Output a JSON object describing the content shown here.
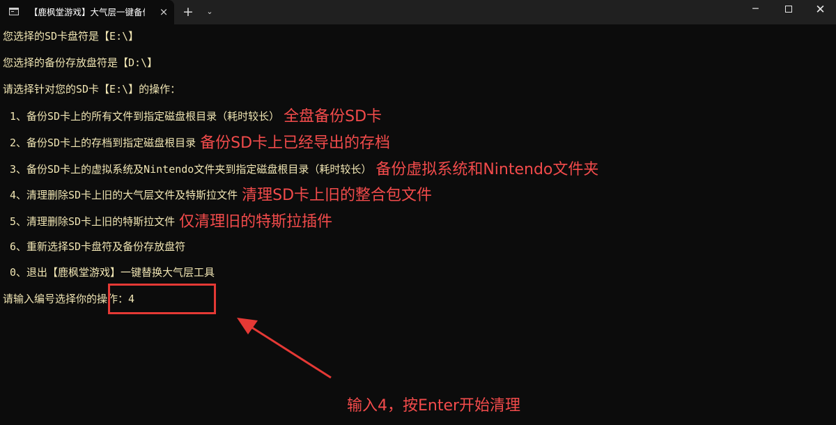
{
  "window": {
    "tab_title": "【鹿枫堂游戏】大气层一键备份",
    "tab_close_icon": "×",
    "new_tab_icon": "+",
    "dropdown_icon": "⌄",
    "minimize_icon": "─",
    "close_icon": "✕"
  },
  "terminal": {
    "lines": [
      "您选择的SD卡盘符是【E:\\】",
      "您选择的备份存放盘符是【D:\\】",
      "请选择针对您的SD卡【E:\\】的操作：",
      "1、备份SD卡上的所有文件到指定磁盘根目录（耗时较长）",
      "2、备份SD卡上的存档到指定磁盘根目录",
      "3、备份SD卡上的虚拟系统及Nintendo文件夹到指定磁盘根目录（耗时较长）",
      "4、清理删除SD卡上旧的大气层文件及特斯拉文件",
      "5、清理删除SD卡上旧的特斯拉文件",
      "6、重新选择SD卡盘符及备份存放盘符",
      "0、退出【鹿枫堂游戏】一键替换大气层工具"
    ],
    "prompt": "请输入编号选择你的操作：",
    "input_value": "4"
  },
  "annotations": {
    "option1_note": "全盘备份SD卡",
    "option2_note": "备份SD卡上已经导出的存档",
    "option3_note": "备份虚拟系统和Nintendo文件夹",
    "option4_note": "清理SD卡上旧的整合包文件",
    "option5_note": "仅清理旧的特斯拉插件",
    "caption": "输入4，按Enter开始清理",
    "accent_color": "#f24b4b"
  },
  "colors": {
    "terminal_bg": "#0c0c0c",
    "terminal_text": "#f1e6b4",
    "titlebar_bg": "#202020"
  }
}
